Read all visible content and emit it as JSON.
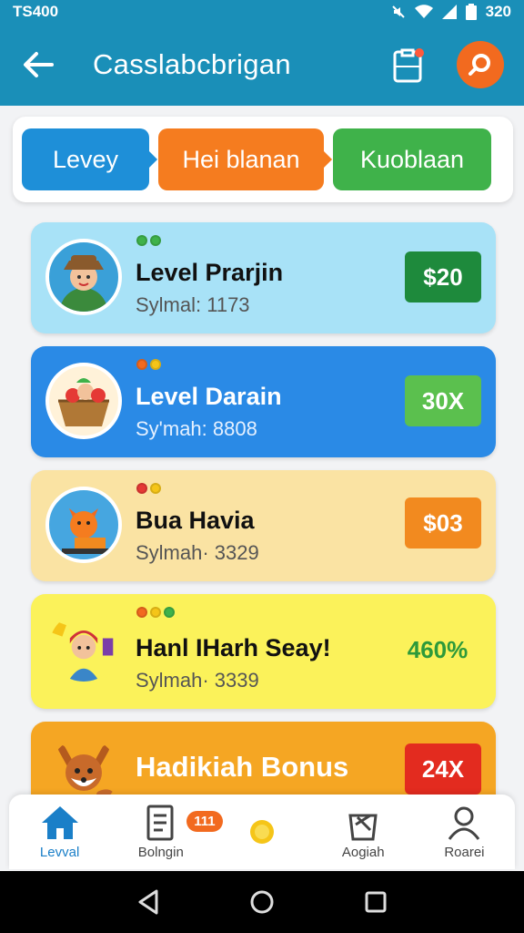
{
  "status_bar": {
    "time": "TS400",
    "battery": "320"
  },
  "app_bar": {
    "title": "Casslabcbrigan"
  },
  "tabs": [
    {
      "label": "Levey"
    },
    {
      "label": "Hei blanan"
    },
    {
      "label": "Kuoblaan"
    }
  ],
  "cards": [
    {
      "title": "Level Prarjin",
      "subtitle": "Sylmal: 1173",
      "badge": "$20",
      "bg": "#a8e2f7",
      "badge_color": "#1e8a3c",
      "title_color": "#111111",
      "sub_color": "#555555",
      "dots": [
        "#3fb24a",
        "#3fb24a"
      ]
    },
    {
      "title": "Level Darain",
      "subtitle": "Sy'mah: 8808",
      "badge": "30X",
      "bg": "#2a8ae6",
      "badge_color": "#5bc04e",
      "title_color": "#ffffff",
      "sub_color": "#e4f0ff",
      "dots": [
        "#f26a1f",
        "#f5c518"
      ]
    },
    {
      "title": "Bua Havia",
      "subtitle": "Sylmah· 3329",
      "badge": "$03",
      "bg": "#fae3a3",
      "badge_color": "#f28a1f",
      "title_color": "#111111",
      "sub_color": "#555555",
      "dots": [
        "#e53935",
        "#f5c518"
      ]
    },
    {
      "title": "Hanl IHarh Seay!",
      "subtitle": "Sylmah· 3339",
      "badge": "460%",
      "bg": "#fbf25a",
      "badge_color": "transparent",
      "badge_text_color": "#2e9a3a",
      "title_color": "#111111",
      "sub_color": "#555555",
      "dots": [
        "#f26a1f",
        "#f5c518",
        "#3fb24a"
      ]
    },
    {
      "title": "Hadikiah Bonus",
      "subtitle": "",
      "badge": "24X",
      "bg": "#f5a623",
      "badge_color": "#e32b1f",
      "title_color": "#ffffff",
      "sub_color": "#ffffff",
      "dots": []
    }
  ],
  "bottom_nav": [
    {
      "label": "Levval",
      "icon": "home-icon",
      "active": true
    },
    {
      "label": "Bolngin",
      "icon": "document-icon",
      "badge": "111"
    },
    {
      "label": "",
      "icon": "coin-icon"
    },
    {
      "label": "Aogiah",
      "icon": "shopping-bag-icon"
    },
    {
      "label": "Roarei",
      "icon": "profile-icon"
    }
  ],
  "colors": {
    "primary": "#1a8fb8",
    "accent": "#f26a1f"
  }
}
